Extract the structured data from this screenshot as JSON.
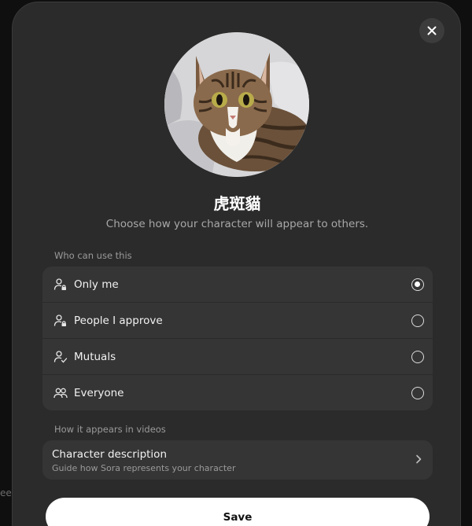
{
  "backdrop": {
    "text": "ee"
  },
  "modal": {
    "close_icon": "close-icon",
    "avatar_alt": "tabby cat",
    "character_name": "虎斑貓",
    "subtitle": "Choose how your character will appear to others.",
    "who_can_use": {
      "label": "Who can use this",
      "options": [
        {
          "label": "Only me",
          "icon": "person-lock-icon",
          "selected": true
        },
        {
          "label": "People I approve",
          "icon": "person-lock-icon",
          "selected": false
        },
        {
          "label": "Mutuals",
          "icon": "person-check-icon",
          "selected": false
        },
        {
          "label": "Everyone",
          "icon": "people-icon",
          "selected": false
        }
      ]
    },
    "appearance": {
      "label": "How it appears in videos",
      "row_title": "Character description",
      "row_subtitle": "Guide how Sora represents your character"
    },
    "save_label": "Save"
  }
}
